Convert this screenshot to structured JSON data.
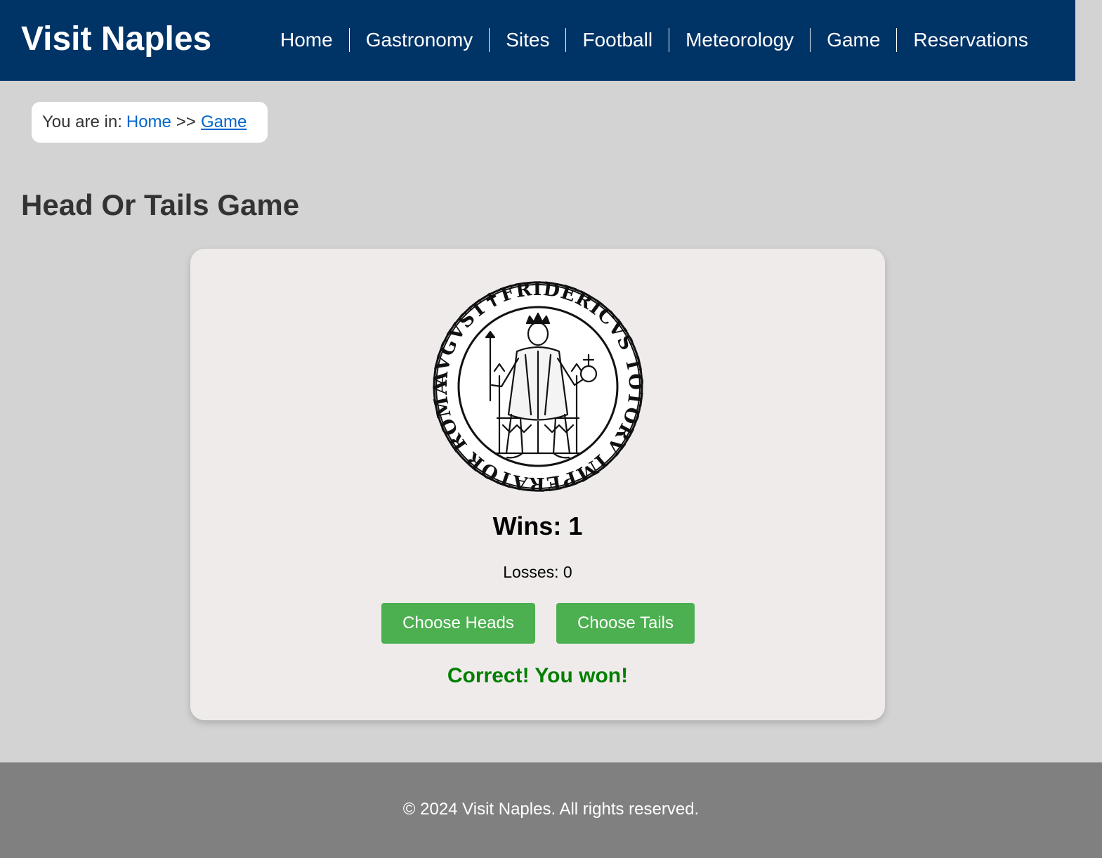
{
  "site": {
    "brand": "Visit Naples"
  },
  "nav": {
    "items": [
      {
        "label": "Home"
      },
      {
        "label": "Gastronomy"
      },
      {
        "label": "Sites"
      },
      {
        "label": "Football"
      },
      {
        "label": "Meteorology"
      },
      {
        "label": "Game"
      },
      {
        "label": "Reservations"
      }
    ]
  },
  "breadcrumb": {
    "prefix": "You are in:",
    "home": "Home",
    "separator": ">>",
    "current": "Game"
  },
  "page": {
    "title": "Head Or Tails Game"
  },
  "game": {
    "coin_image": {
      "icon": "seal-of-frederick-ii-icon",
      "inscription": "AVGVST✝FRIDERICVS TOTORV IMPERATOR ROMANORV SEMP"
    },
    "wins": "Wins: 1",
    "losses": "Losses: 0",
    "heads_button": "Choose Heads",
    "tails_button": "Choose Tails",
    "result": "Correct! You won!"
  },
  "footer": {
    "text": "© 2024 Visit Naples. All rights reserved."
  },
  "colors": {
    "header_bg": "#003366",
    "page_bg": "#d3d3d3",
    "card_bg": "#f0ebeb",
    "button_bg": "#4caf50",
    "result_text": "#008000",
    "footer_bg": "#808080",
    "link": "#0066cc"
  }
}
